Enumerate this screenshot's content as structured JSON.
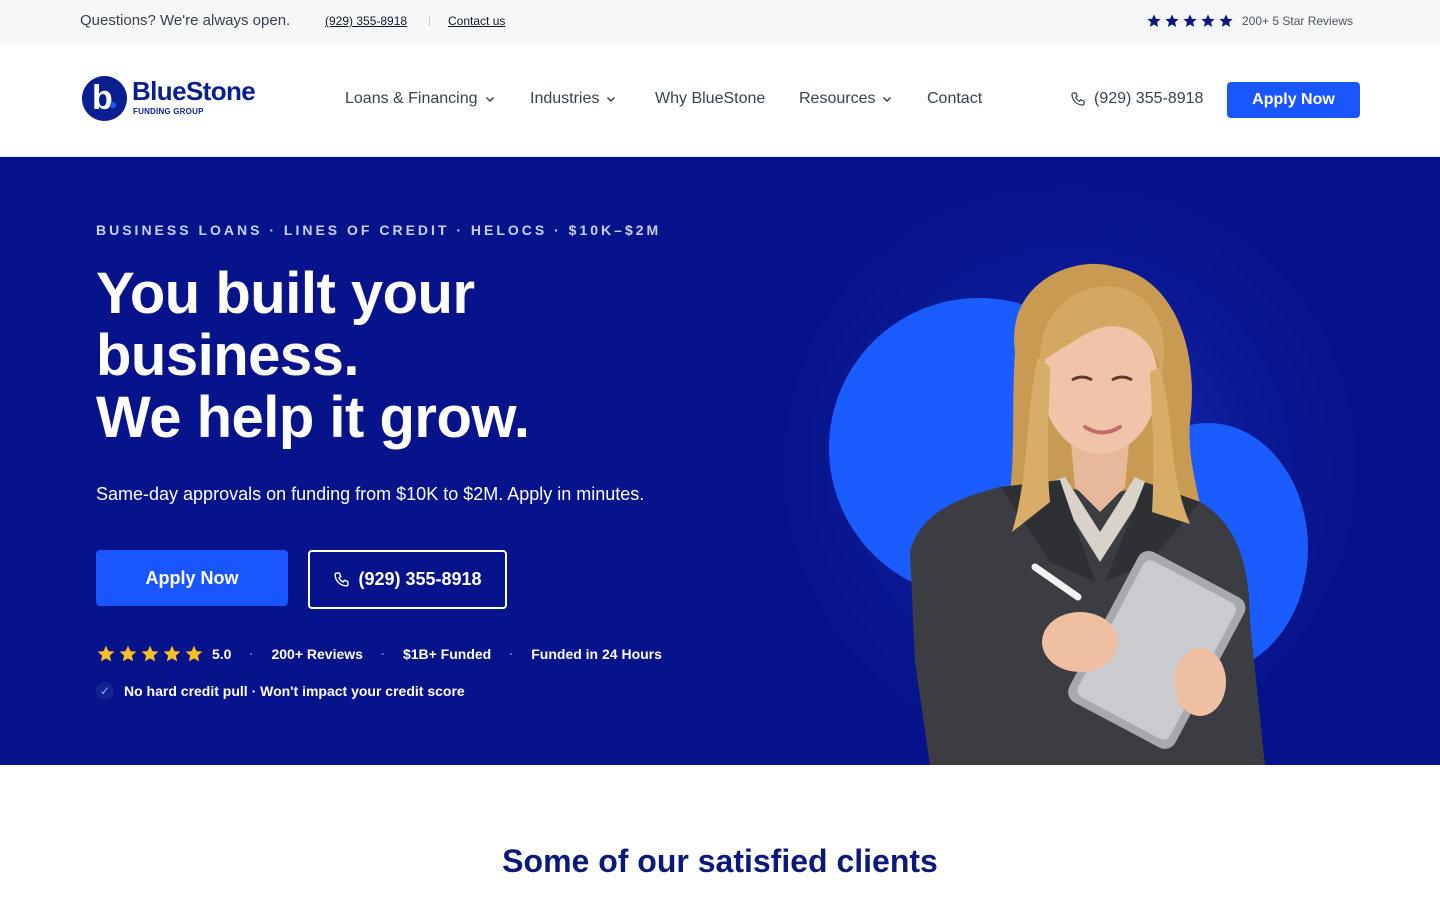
{
  "topbar": {
    "question": "Questions? We're always open.",
    "phone": "(929) 355-8918",
    "separator": "|",
    "contact": "Contact us",
    "reviews": "200+ 5 Star Reviews",
    "star_color": "#0b1a7a"
  },
  "header": {
    "logo_name": "BlueStone",
    "logo_sub": "FUNDING GROUP",
    "logo_letter": "b",
    "nav": [
      {
        "label": "Loans & Financing",
        "dropdown": true
      },
      {
        "label": "Industries",
        "dropdown": true
      },
      {
        "label": "Why BlueStone",
        "dropdown": false
      },
      {
        "label": "Resources",
        "dropdown": true
      },
      {
        "label": "Contact",
        "dropdown": false
      }
    ],
    "phone": "(929) 355-8918",
    "apply": "Apply Now"
  },
  "hero": {
    "kicker": "BUSINESS LOANS · LINES OF CREDIT · HELOCS · $10K–$2M",
    "title_lines": [
      "You built your",
      "business.",
      "We help it grow."
    ],
    "lead": "Same-day approvals on funding from $10K to $2M. Apply in minutes.",
    "apply": "Apply Now",
    "call": "(929) 355-8918",
    "rating": "5.0",
    "rating_stars": 5,
    "stats": [
      "200+ Reviews",
      "$1B+ Funded",
      "Funded in 24 Hours"
    ],
    "dot": "·",
    "credit_note": "No hard credit pull · Won't impact your credit score",
    "check": "✓",
    "colors": {
      "background": "#07138a",
      "accent": "#1a56ff",
      "star": "#fbbf24"
    }
  },
  "clients": {
    "title": "Some of our satisfied clients"
  }
}
